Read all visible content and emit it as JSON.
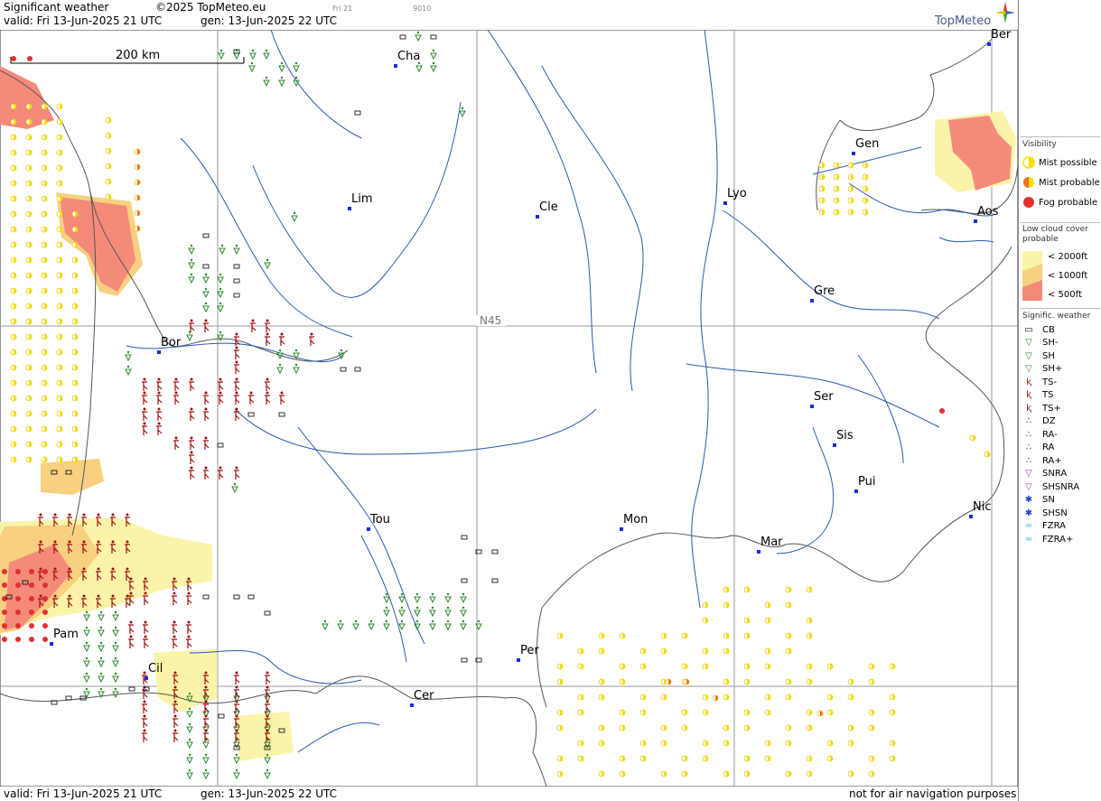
{
  "header": {
    "title": "Significant weather",
    "copyright": "©2025 TopMeteo.eu",
    "valid": "valid:  Fri  13-Jun-2025  21 UTC",
    "gen": "gen: 13-Jun-2025 22 UTC",
    "small_day": "Fri 21",
    "small_code": "9010",
    "logo": "TopMeteo"
  },
  "footer": {
    "valid": "valid:  Fri  13-Jun-2025  21 UTC",
    "gen": "gen: 13-Jun-2025 22 UTC",
    "disclaimer": "not for air navigation purposes"
  },
  "map": {
    "scale_label": "200 km",
    "latitude_label": "N45",
    "cities": [
      {
        "name": "Cha"
      },
      {
        "name": "Ber"
      },
      {
        "name": "Gen"
      },
      {
        "name": "Lim"
      },
      {
        "name": "Cle"
      },
      {
        "name": "Lyo"
      },
      {
        "name": "Aos"
      },
      {
        "name": "Gre"
      },
      {
        "name": "Bor"
      },
      {
        "name": "Ser"
      },
      {
        "name": "Sis"
      },
      {
        "name": "Pui"
      },
      {
        "name": "Tou"
      },
      {
        "name": "Mon"
      },
      {
        "name": "Mar"
      },
      {
        "name": "Nic"
      },
      {
        "name": "Pam"
      },
      {
        "name": "Per"
      },
      {
        "name": "Cil"
      },
      {
        "name": "Cer"
      }
    ],
    "colors": {
      "mist_possible": "#f5e000",
      "mist_probable": "#f07020",
      "fog_probable": "#e03030",
      "low_cloud_2000": "#fbf4a8",
      "low_cloud_1000": "#f8d080",
      "low_cloud_500": "#f58a7a",
      "shower": "#2a8a2a",
      "thunderstorm": "#a01010",
      "grid": "#999999",
      "river": "#2a5ab0"
    }
  },
  "legend": {
    "visibility_title": "Visibility",
    "mist_possible": "Mist possible",
    "mist_probable": "Mist probable",
    "fog_probable": "Fog probable",
    "low_cloud_title": "Low cloud cover probable",
    "lc_2000": "< 2000ft",
    "lc_1000": "< 1000ft",
    "lc_500": "<   500ft",
    "sigwx_title": "Signific. weather",
    "items": [
      "CB",
      "SH-",
      "SH",
      "SH+",
      "TS-",
      "TS",
      "TS+",
      "DZ",
      "RA-",
      "RA",
      "RA+",
      "SNRA",
      "SHSNRA",
      "SN",
      "SHSN",
      "FZRA",
      "FZRA+"
    ]
  }
}
